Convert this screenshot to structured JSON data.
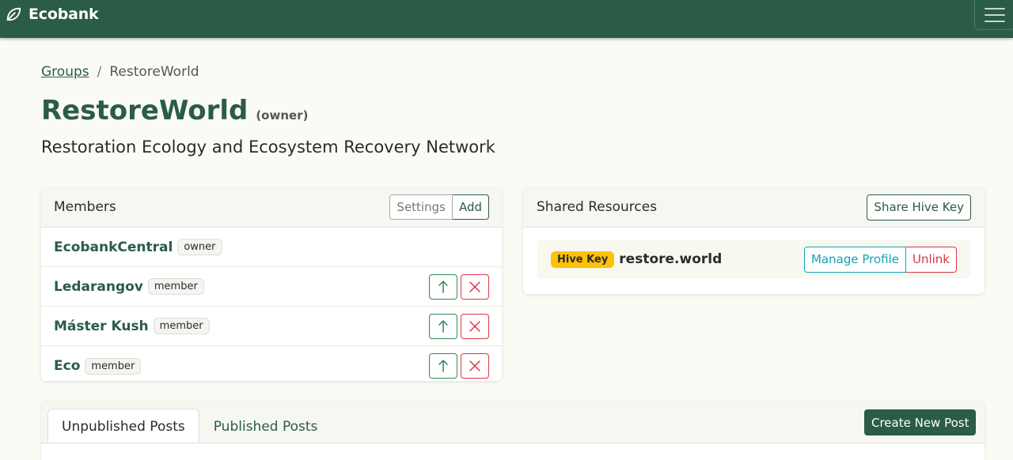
{
  "app": {
    "brand": "Ecobank"
  },
  "colors": {
    "brand": "#2a5c48",
    "hive_key": "#ffc107",
    "danger": "#dc3545",
    "info": "#17a2b8",
    "success": "#2e8b57"
  },
  "icons": {
    "logo": "leaf-icon",
    "menu": "hamburger-icon",
    "promote": "arrow-up-icon",
    "remove": "close-icon"
  },
  "breadcrumb": {
    "parent": "Groups",
    "separator": "/",
    "current": "RestoreWorld"
  },
  "group": {
    "name": "RestoreWorld",
    "role": "(owner)",
    "description": "Restoration Ecology and Ecosystem Recovery Network"
  },
  "members": {
    "title": "Members",
    "settings_label": "Settings",
    "add_label": "Add",
    "list": [
      {
        "name": "EcobankCentral",
        "role": "owner"
      },
      {
        "name": "Ledarangov",
        "role": "member"
      },
      {
        "name": "Máster Kush",
        "role": "member"
      },
      {
        "name": "Eco",
        "role": "member"
      }
    ]
  },
  "resources": {
    "title": "Shared Resources",
    "share_label": "Share Hive Key",
    "items": [
      {
        "badge": "Hive Key",
        "name": "restore.world",
        "manage_label": "Manage Profile",
        "unlink_label": "Unlink"
      }
    ]
  },
  "posts": {
    "tabs": [
      {
        "label": "Unpublished Posts",
        "active": true
      },
      {
        "label": "Published Posts",
        "active": false
      }
    ],
    "create_label": "Create New Post"
  }
}
